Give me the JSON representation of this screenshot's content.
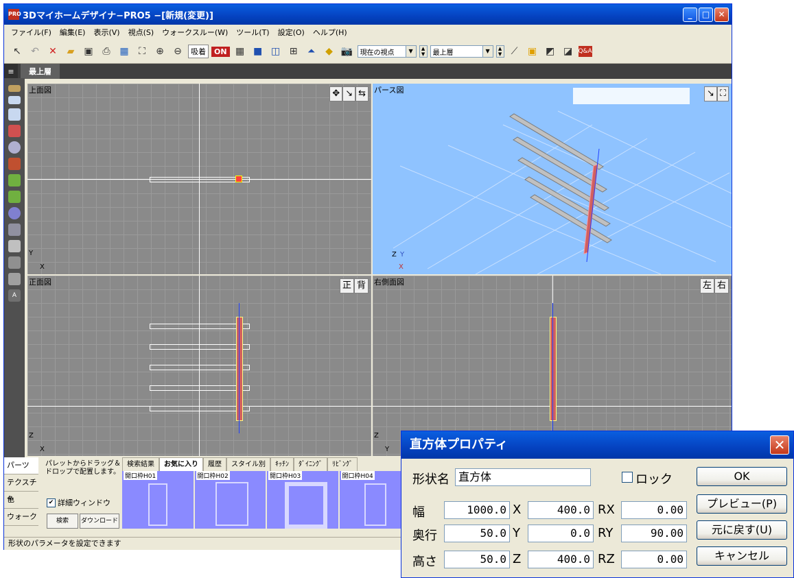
{
  "window": {
    "title": "3Dマイホームデザイナ−PRO5 −[新規(変更)]",
    "app_icon_text": "PRO",
    "minimize_glyph": "_",
    "maximize_glyph": "□",
    "close_glyph": "✕"
  },
  "menu": [
    "ファイル(F)",
    "編集(E)",
    "表示(V)",
    "視点(S)",
    "ウォークスルー(W)",
    "ツール(T)",
    "設定(O)",
    "ヘルプ(H)"
  ],
  "toolbar": {
    "snap_label": "吸着",
    "snap_state": "ON",
    "viewpoint_value": "現在の視点",
    "floor_value": "最上層",
    "help_label": "Q&A"
  },
  "layer_tab": "最上層",
  "views": {
    "top": "上面図",
    "perspective": "パース図",
    "front": "正面図",
    "right": "右側面図",
    "front_btn": "正",
    "back_btn": "背",
    "left_btn": "左",
    "right_btn": "右",
    "axis_x": "X",
    "axis_y": "Y",
    "axis_z": "Z"
  },
  "bottom": {
    "side_tabs": [
      "パーツ",
      "テクスチャ",
      "色",
      "ウォーク"
    ],
    "drag_hint": "パレットからドラッグ＆ドロップで配置します。",
    "detail_window": "詳細ウィンドウ",
    "search_btn": "検索",
    "download_btn": "ダウンロード",
    "tabs": [
      "検索結果",
      "お気に入り",
      "履歴",
      "スタイル別",
      "ｷｯﾁﾝ",
      "ﾀﾞｲﾆﾝｸﾞ",
      "ﾘﾋﾞﾝｸﾞ"
    ],
    "tiles": [
      "開口枠H01",
      "開口枠H02",
      "開口枠H03",
      "開口枠H04"
    ]
  },
  "status_text": "形状のパラメータを設定できます",
  "dialog": {
    "title": "直方体プロパティ",
    "shape_name_label": "形状名",
    "shape_name_value": "直方体",
    "lock_label": "ロック",
    "width_label": "幅",
    "depth_label": "奥行",
    "height_label": "高さ",
    "width": "1000.0",
    "depth": "50.0",
    "height": "50.0",
    "x_label": "X",
    "y_label": "Y",
    "z_label": "Z",
    "x": "400.0",
    "y": "0.0",
    "z": "400.0",
    "rx_label": "RX",
    "ry_label": "RY",
    "rz_label": "RZ",
    "rx": "0.00",
    "ry": "90.00",
    "rz": "0.00",
    "ok": "OK",
    "preview": "プレビュー(P)",
    "revert": "元に戻す(U)",
    "cancel": "キャンセル"
  }
}
